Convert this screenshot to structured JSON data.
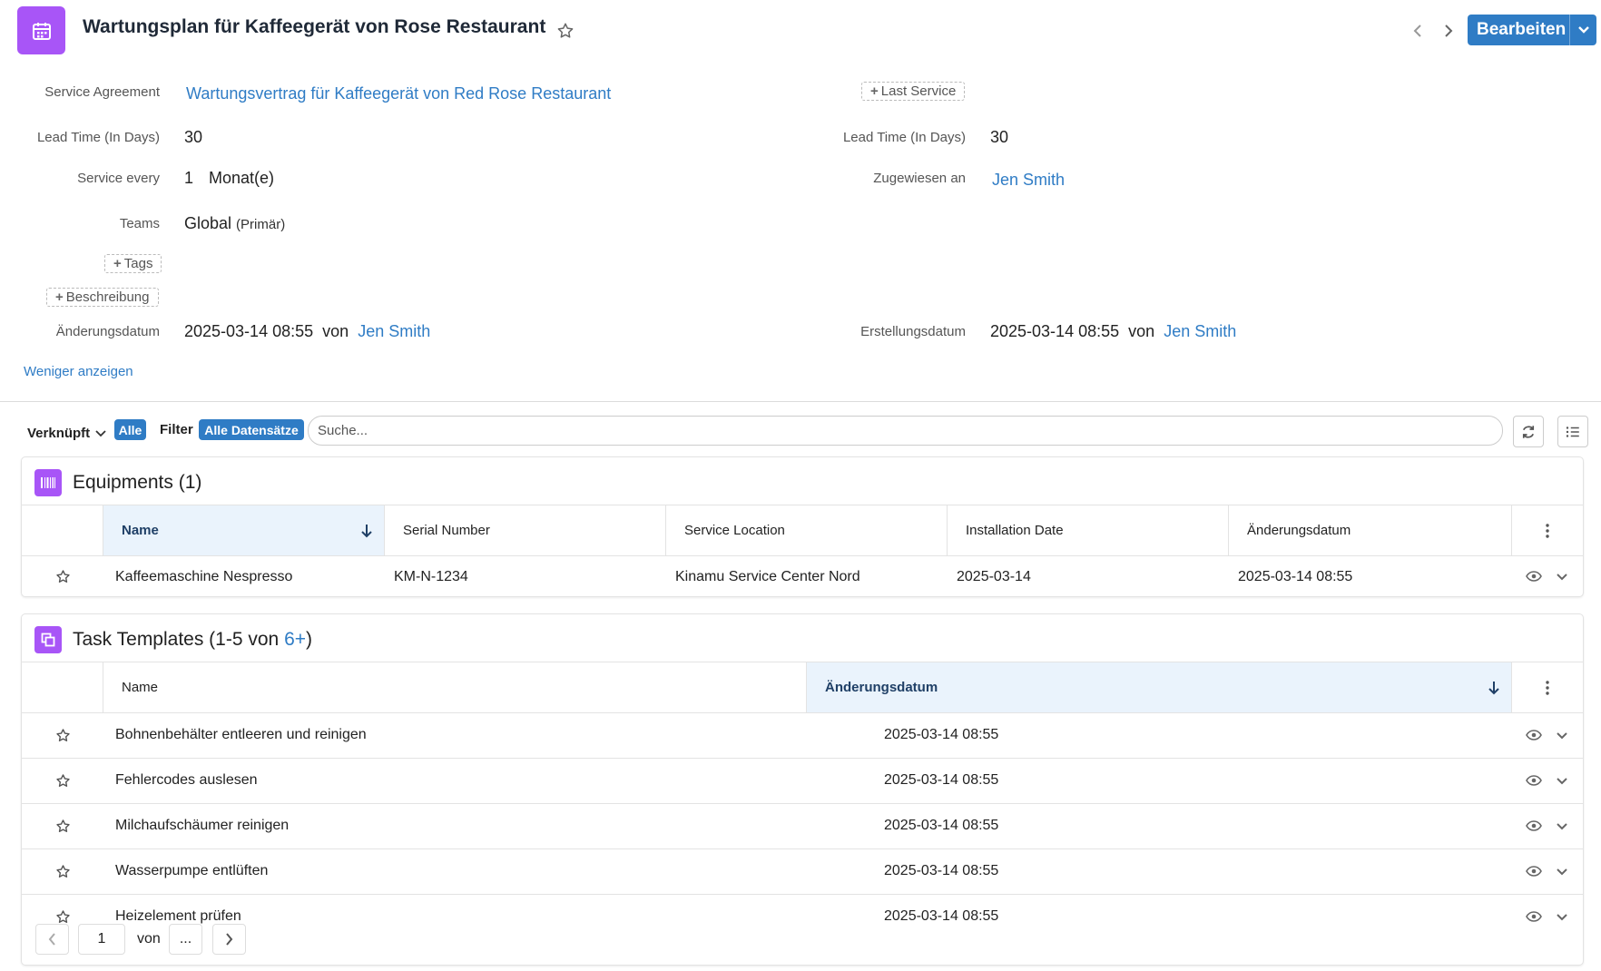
{
  "header": {
    "icon": "calendar-icon",
    "title": "Wartungsplan für Kaffeegerät von Rose Restaurant",
    "edit_label": "Bearbeiten",
    "accent_color": "#a855f7",
    "primary_color": "#2f7cc5"
  },
  "fields": {
    "service_agreement_label": "Service Agreement",
    "service_agreement_value": "Wartungsvertrag für Kaffeegerät von Red Rose Restaurant",
    "last_service_label": "Last Service",
    "lead_time_label": "Lead Time (In Days)",
    "lead_time_value": "30",
    "lead_time_label_2": "Lead Time (In Days)",
    "lead_time_value_2": "30",
    "service_every_label": "Service every",
    "service_every_number": "1",
    "service_every_unit": "Monat(e)",
    "assigned_label": "Zugewiesen an",
    "assigned_value": "Jen Smith",
    "teams_label": "Teams",
    "teams_value": "Global",
    "teams_primary": "(Primär)",
    "tags_label": "Tags",
    "description_label": "Beschreibung",
    "modified_label": "Änderungsdatum",
    "modified_value": "2025-03-14 08:55",
    "modified_by_word": "von",
    "modified_by": "Jen Smith",
    "created_label": "Erstellungsdatum",
    "created_value": "2025-03-14 08:55",
    "created_by_word": "von",
    "created_by": "Jen Smith",
    "show_less": "Weniger anzeigen"
  },
  "filterbar": {
    "linked_label": "Verknüpft",
    "all_pill": "Alle",
    "filter_label": "Filter",
    "all_records_pill": "Alle Datensätze",
    "search_placeholder": "Suche..."
  },
  "equipments": {
    "title": "Equipments (1)",
    "columns": [
      "Name",
      "Serial Number",
      "Service Location",
      "Installation Date",
      "Änderungsdatum"
    ],
    "rows": [
      {
        "name": "Kaffeemaschine Nespresso",
        "serial": "KM-N-1234",
        "location": "Kinamu Service Center Nord",
        "install_date": "2025-03-14",
        "modified": "2025-03-14 08:55"
      }
    ]
  },
  "tasks": {
    "title_prefix": "Task Templates (1-5 von ",
    "title_count": "6+",
    "title_suffix": ")",
    "columns": [
      "Name",
      "Änderungsdatum"
    ],
    "rows": [
      {
        "name": "Bohnenbehälter entleeren und reinigen",
        "modified": "2025-03-14 08:55"
      },
      {
        "name": "Fehlercodes auslesen",
        "modified": "2025-03-14 08:55"
      },
      {
        "name": "Milchaufschäumer reinigen",
        "modified": "2025-03-14 08:55"
      },
      {
        "name": "Wasserpumpe entlüften",
        "modified": "2025-03-14 08:55"
      },
      {
        "name": "Heizelement prüfen",
        "modified": "2025-03-14 08:55"
      }
    ]
  },
  "pager": {
    "page": "1",
    "of_word": "von",
    "total": "..."
  }
}
